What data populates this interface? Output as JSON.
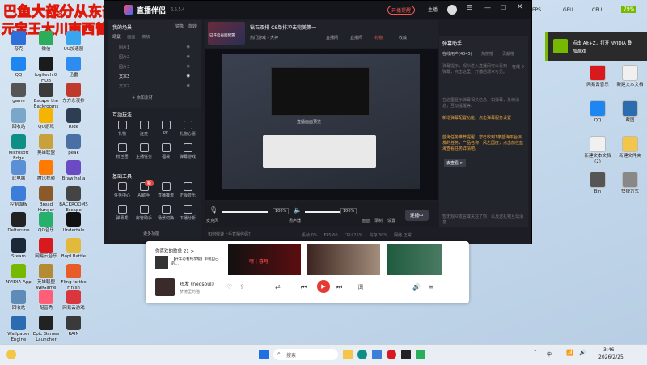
{
  "overlay": {
    "line1": "巴鱼大部分从东部神器",
    "vs": "VS",
    "line2": "元宝王大川南西曾优秀胡酱"
  },
  "desktop_left": [
    {
      "label": "夸克",
      "color": "#2f6fd9"
    },
    {
      "label": "微信",
      "color": "#2aae5c"
    },
    {
      "label": "UU加速器",
      "color": "#39a5f0"
    },
    {
      "label": "QQ",
      "color": "#1e86f0"
    },
    {
      "label": "logitech G HUB",
      "color": "#1b1b1b"
    },
    {
      "label": "迅雷",
      "color": "#2d8cf0"
    },
    {
      "label": "game",
      "color": "#555"
    },
    {
      "label": "Escape the Backrooms",
      "color": "#3a3a3a"
    },
    {
      "label": "东方永夜抄",
      "color": "#c0392b"
    },
    {
      "label": "回收站",
      "color": "#7aa6c9"
    },
    {
      "label": "QQ游戏",
      "color": "#f5b400"
    },
    {
      "label": "Ride",
      "color": "#2c3e50"
    },
    {
      "label": "Microsoft Edge",
      "color": "#0d8f86"
    },
    {
      "label": "英雄联盟",
      "color": "#c9a13b"
    },
    {
      "label": "peak",
      "color": "#4a6fa5"
    },
    {
      "label": "此电脑",
      "color": "#5a8fd6"
    },
    {
      "label": "腾讯视频",
      "color": "#ff7a00"
    },
    {
      "label": "Brawlhalla",
      "color": "#6a4bc4"
    },
    {
      "label": "控制面板",
      "color": "#3b7dd8"
    },
    {
      "label": "Bread Hunger",
      "color": "#8a5a2b"
    },
    {
      "label": "BACKROOMS Escape",
      "color": "#444"
    },
    {
      "label": "Deltarune",
      "color": "#222"
    },
    {
      "label": "QQ音乐",
      "color": "#27b06b"
    },
    {
      "label": "Undertale",
      "color": "#111"
    },
    {
      "label": "Steam",
      "color": "#1b2838"
    },
    {
      "label": "网易云音乐",
      "color": "#d8191e"
    },
    {
      "label": "Bopl Battle",
      "color": "#e2b93b"
    },
    {
      "label": "NVIDIA App",
      "color": "#76b900"
    },
    {
      "label": "英雄联盟WeGame",
      "color": "#b48b32"
    },
    {
      "label": "Fling to the Finish",
      "color": "#e85c2a"
    },
    {
      "label": "回收站",
      "color": "#5e8bb8"
    },
    {
      "label": "配音秀",
      "color": "#ff5e79"
    },
    {
      "label": "网易云游戏",
      "color": "#d9363e"
    },
    {
      "label": "Wallpaper Engine",
      "color": "#2b6cb0"
    },
    {
      "label": "Epic Games Launcher",
      "color": "#222"
    },
    {
      "label": "RAIN",
      "color": "#3a3a3a"
    }
  ],
  "desktop_right": [
    {
      "label": "网易云音乐",
      "color": "#d8191e"
    },
    {
      "label": "新建文本文档",
      "color": "#f0f0f0"
    },
    {
      "label": "QQ",
      "color": "#1e86f0"
    },
    {
      "label": "截图",
      "color": "#2b6cb0"
    },
    {
      "label": "新建文本文档(2)",
      "color": "#f0f0f0"
    },
    {
      "label": "新建文件夹",
      "color": "#f3c64a"
    },
    {
      "label": "Bin",
      "color": "#555"
    },
    {
      "label": "快捷方式",
      "color": "#888"
    }
  ],
  "topbar": {
    "fps": "FPS",
    "gpu": "GPU",
    "cpu": "CPU",
    "num": "79%",
    "items": [
      "腾讯会议",
      "网易云音乐",
      "TeamSpeak",
      "录制中"
    ]
  },
  "nvidia": {
    "line1": "点击 Alt+Z，打开 NVIDIA 叠",
    "line2": "加游戏"
  },
  "app": {
    "title": "直播伴侣",
    "version": "6.5.5.4",
    "header_btns": [
      "开播提醒",
      "主播"
    ],
    "room_title": "钻石双排-CS单排冲击完美第一",
    "room_badge": "已开启画面配置",
    "hot": "热门游戏 - 大神",
    "stats": [
      "直播间",
      "直播间",
      "礼物",
      "收藏"
    ],
    "left_tabs": [
      "镜像",
      "旋转"
    ],
    "scene_head": "我的场景",
    "scene_tabs": [
      "场景",
      "画面",
      "高级"
    ],
    "sources": [
      "图片1",
      "图片2",
      "图片3",
      "文本3",
      "文本2"
    ],
    "add_source": "+ 添加素材",
    "interact_title": "互动玩法",
    "interact": [
      {
        "label": "礼物",
        "badge": ""
      },
      {
        "label": "连麦",
        "badge": ""
      },
      {
        "label": "PK",
        "badge": ""
      },
      {
        "label": "礼物心愿",
        "badge": ""
      },
      {
        "label": "粉丝团",
        "badge": ""
      },
      {
        "label": "主播任务",
        "badge": ""
      },
      {
        "label": "福袋",
        "badge": ""
      },
      {
        "label": "弹幕游戏",
        "badge": ""
      }
    ],
    "tools_title": "基础工具",
    "tools": [
      {
        "label": "任务中心",
        "badge": ""
      },
      {
        "label": "AI助手",
        "badge": "新"
      },
      {
        "label": "直播推流",
        "badge": ""
      },
      {
        "label": "正版音乐",
        "badge": ""
      },
      {
        "label": "弹幕秀",
        "badge": ""
      },
      {
        "label": "房管助手",
        "badge": ""
      },
      {
        "label": "场景切换",
        "badge": ""
      },
      {
        "label": "下播分析",
        "badge": ""
      }
    ],
    "more": "更多功能",
    "preview_text": "直播画面预览",
    "mic_label": "麦克风",
    "mic_value": "100%",
    "spk_label": "扬声器",
    "spk_value": "100%",
    "ctrl": [
      "画面",
      "录制",
      "设置"
    ],
    "live_btn": "连播中",
    "status_left": "如何快速上手直播伴侣？",
    "status_right": [
      "丢帧 0%",
      "FPS 60",
      "CPU 25%",
      "内存 30%",
      "网络 正常"
    ],
    "chat_title": "弹幕助手",
    "chat_tabs": [
      "在线用户(4045)",
      "热搜榜",
      "贡献榜"
    ],
    "chat_count": "在线 0",
    "chat_tip1": "弹幕提示，观众进入直播间可以看到弹幕，点击这里，开播后观众可见。",
    "chat_tip2": "在这里显示弹幕相关信息，如弹幕，系统消息，互动提醒等。",
    "chat_notice_title": "新增弹幕配置功能，点击弹幕服务设置",
    "chat_notice": "蓝海任务推荐提醒：您已收到1条蓝海平台派发的任务，产品名称：风之国度，点击前往蓝海查看任务详情吧。",
    "chat_link": "去查看 >",
    "chat_bottom": "暂无观众发言或关注了你，以及送礼物互动消息"
  },
  "music": {
    "header": "你喜欢的歌单 21 >",
    "card_text": "【开年必看纯享版】审视自己的…",
    "card2": "嘿 | 暮月",
    "song": "短发 (neosoul)",
    "artist": "梦境里的猫"
  },
  "taskbar": {
    "search": "搜索",
    "time": "3:46",
    "date": "2026/2/25",
    "lang": "中"
  }
}
